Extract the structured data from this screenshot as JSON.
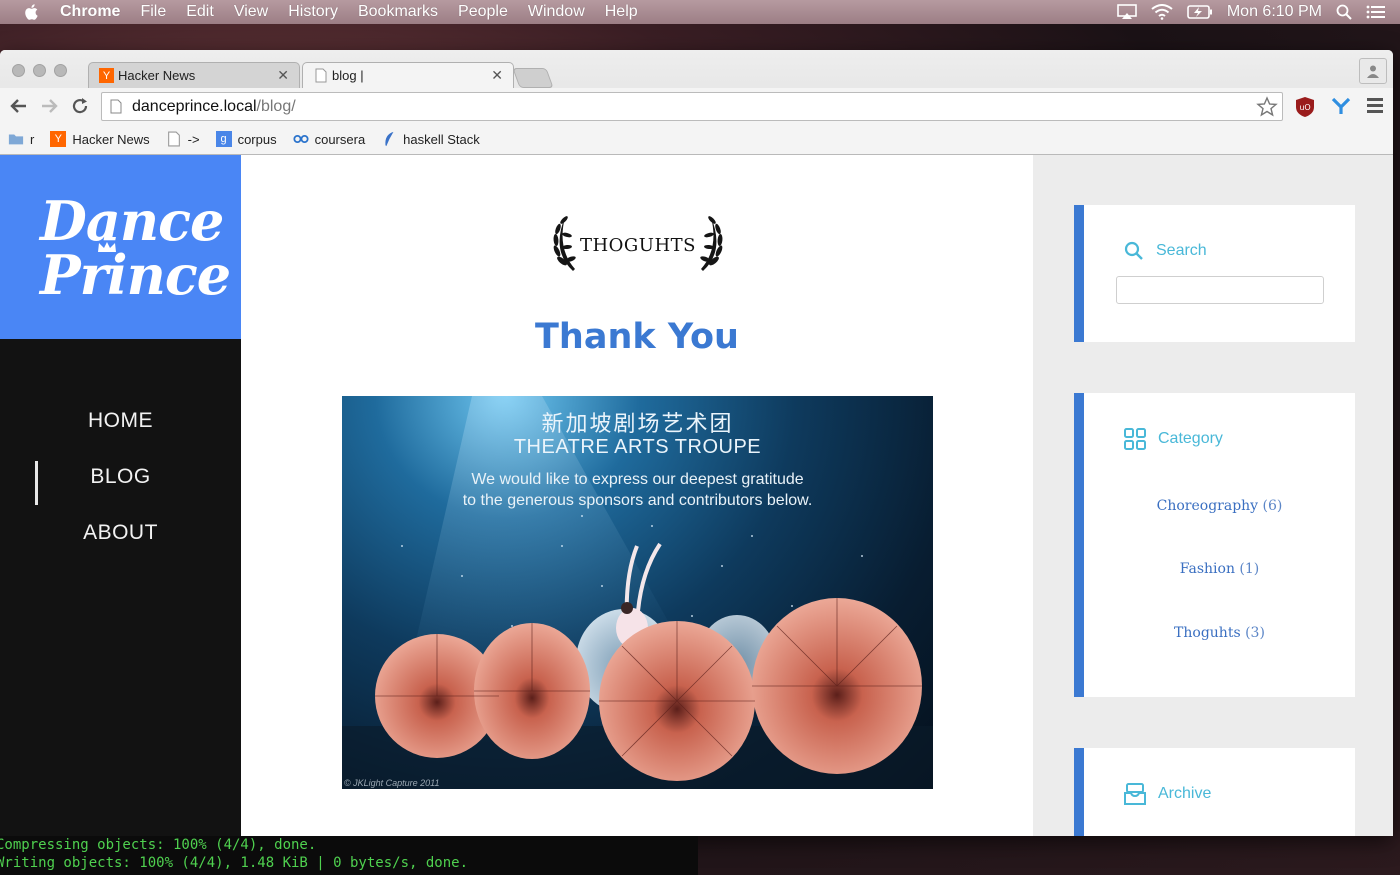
{
  "menubar": {
    "app": "Chrome",
    "items": [
      "File",
      "Edit",
      "View",
      "History",
      "Bookmarks",
      "People",
      "Window",
      "Help"
    ],
    "clock": "Mon 6:10 PM"
  },
  "tabs": [
    {
      "title": "Hacker News",
      "favicon": "Y",
      "favicon_color": "#ff6600"
    },
    {
      "title": "blog |",
      "favicon": "page-icon",
      "favicon_color": "#ffffff"
    }
  ],
  "address": {
    "host": "danceprince.local",
    "path": "/blog/"
  },
  "bookmarks": [
    {
      "label": "r",
      "icon": "folder-icon"
    },
    {
      "label": "Hacker News",
      "icon": "Y"
    },
    {
      "label": "->",
      "icon": "page-icon"
    },
    {
      "label": "corpus",
      "icon": "google-icon"
    },
    {
      "label": "coursera",
      "icon": "coursera-icon"
    },
    {
      "label": "haskell Stack",
      "icon": "feather-icon"
    }
  ],
  "site": {
    "logo_line1": "Dance",
    "logo_line2": "Prince",
    "nav": [
      "HOME",
      "BLOG",
      "ABOUT"
    ],
    "active_nav": "BLOG",
    "brand_color": "#4a86f5",
    "accent_color": "#3b79d2"
  },
  "post": {
    "category_badge": "THOGUHTS",
    "title": "Thank You",
    "image": {
      "cn_text": "新加坡剧场艺术团",
      "troupe": "THEATRE ARTS TROUPE",
      "message_line1": "We would like to express our deepest gratitude",
      "message_line2": "to the generous sponsors and contributors below.",
      "credit": "© JKLight Capture 2011"
    }
  },
  "sidebar": {
    "search": {
      "label": "Search",
      "placeholder": ""
    },
    "category": {
      "label": "Category",
      "items": [
        {
          "name": "Choreography",
          "count": "(6)"
        },
        {
          "name": "Fashion",
          "count": "(1)"
        },
        {
          "name": "Thoguhts",
          "count": "(3)"
        }
      ]
    },
    "archive": {
      "label": "Archive"
    }
  },
  "terminal": {
    "lines": [
      "Compressing objects: 100% (4/4), done.",
      "Writing objects: 100% (4/4), 1.48 KiB | 0 bytes/s, done."
    ]
  }
}
